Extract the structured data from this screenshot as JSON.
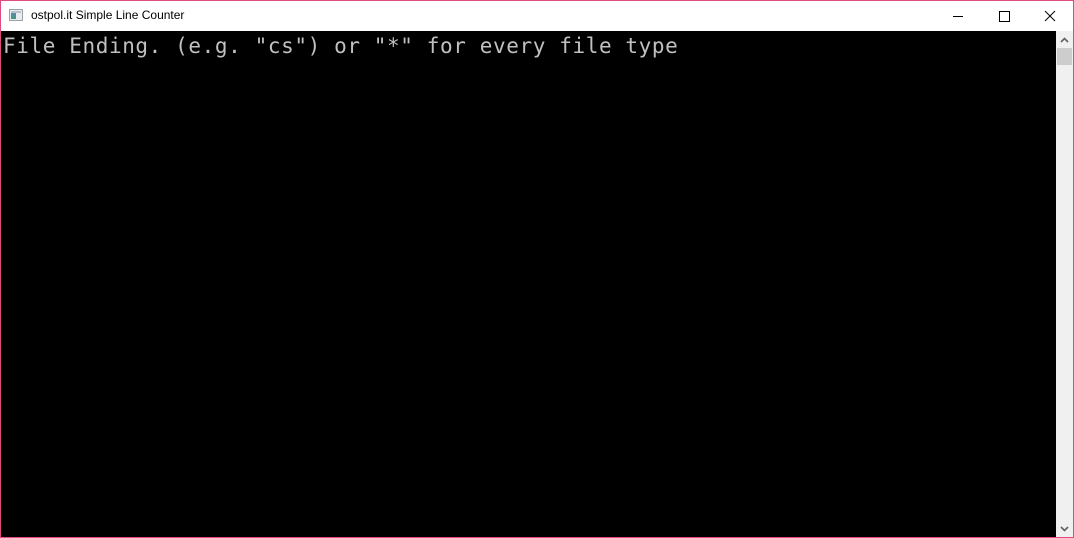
{
  "window": {
    "title": "ostpol.it Simple Line Counter",
    "border_color": "#e04a7f",
    "icons": {
      "app": "console-window-icon",
      "minimize": "minimize-icon",
      "maximize": "maximize-icon",
      "close": "close-icon"
    }
  },
  "console": {
    "background": "#000000",
    "text_color": "#c0c0c0",
    "lines": [
      "File Ending. (e.g. \"cs\") or \"*\" for every file type"
    ]
  },
  "scrollbar": {
    "up_icon": "chevron-up-icon",
    "down_icon": "chevron-down-icon",
    "position": 0
  }
}
